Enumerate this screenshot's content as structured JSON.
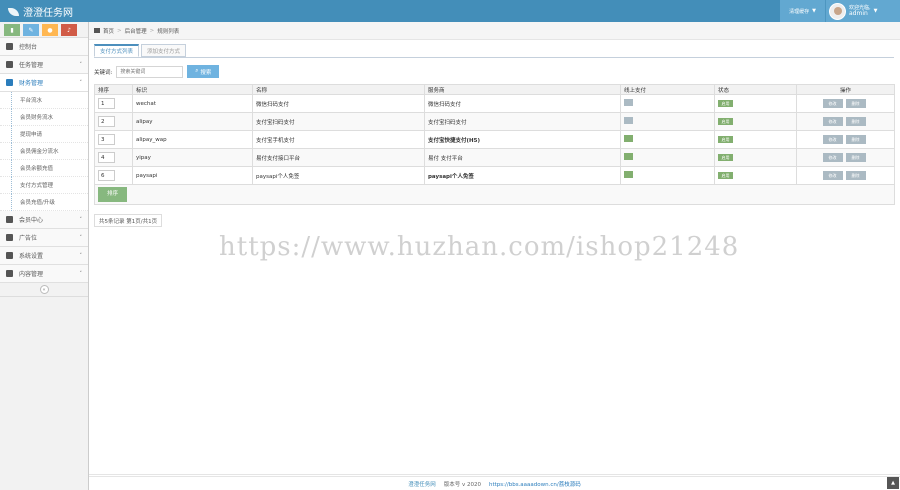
{
  "navbar": {
    "brand": "澄澄任务网",
    "clear_cache": "清理缓存",
    "welcome": "欢迎光临,",
    "username": "admin"
  },
  "sidebar": {
    "menu": [
      {
        "label": "控制台",
        "icon": "dashboard-icon"
      },
      {
        "label": "任务管理",
        "icon": "flag-icon"
      },
      {
        "label": "财务管理",
        "icon": "finance-icon",
        "open": true
      }
    ],
    "submenu": [
      "平台流水",
      "会员财务流水",
      "提现申请",
      "会员佣金分流水",
      "会员余额充值",
      "支付方式管理",
      "会员充值/升级"
    ],
    "menu_after": [
      {
        "label": "会员中心",
        "icon": "user-icon"
      },
      {
        "label": "广告位",
        "icon": "ad-icon"
      },
      {
        "label": "系统设置",
        "icon": "gear-icon"
      },
      {
        "label": "内容管理",
        "icon": "content-icon"
      }
    ]
  },
  "breadcrumb": [
    "首页",
    "后台管理",
    "规则列表"
  ],
  "tabs": [
    "支付方式列表",
    "添加支付方式"
  ],
  "search": {
    "label": "关键词:",
    "placeholder": "搜索关键词",
    "button": "搜索"
  },
  "table": {
    "headers": [
      "排序",
      "标识",
      "名称",
      "服务商",
      "线上支付",
      "状态",
      "操作"
    ],
    "rows": [
      {
        "sort": "1",
        "code": "wechat",
        "name": "微信扫码支付",
        "provider": "微信扫码支付",
        "provider_bold": false,
        "online": "gray",
        "state": "启用"
      },
      {
        "sort": "2",
        "code": "alipay",
        "name": "支付宝扫码支付",
        "provider": "支付宝扫码支付",
        "provider_bold": false,
        "online": "gray",
        "state": "启用"
      },
      {
        "sort": "3",
        "code": "alipay_wap",
        "name": "支付宝手机支付",
        "provider": "支付宝快捷支付(H5)",
        "provider_bold": true,
        "online": "green",
        "state": "启用"
      },
      {
        "sort": "4",
        "code": "yipay",
        "name": "易付支付接口平台",
        "provider": "易付 支付平台",
        "provider_bold": false,
        "online": "green",
        "state": "启用"
      },
      {
        "sort": "6",
        "code": "paysapi",
        "name": "paysapi个人免签",
        "provider": "paysapi个人免签",
        "provider_bold": true,
        "online": "green",
        "state": "启用"
      }
    ],
    "op_edit": "修改",
    "op_delete": "删除",
    "sort_button": "排序"
  },
  "pager": "共5条记录 第1页/共1页",
  "watermark": "https://www.huzhan.com/ishop21248",
  "footer": {
    "brand": "澄澄任务网",
    "version": "版本号 v 2020",
    "link": "https://bbs.aaaadown.cn/荔枝源码"
  },
  "colors": {
    "navbar": "#438eb9",
    "accent": "#6fb3e0",
    "success": "#87b87f"
  }
}
